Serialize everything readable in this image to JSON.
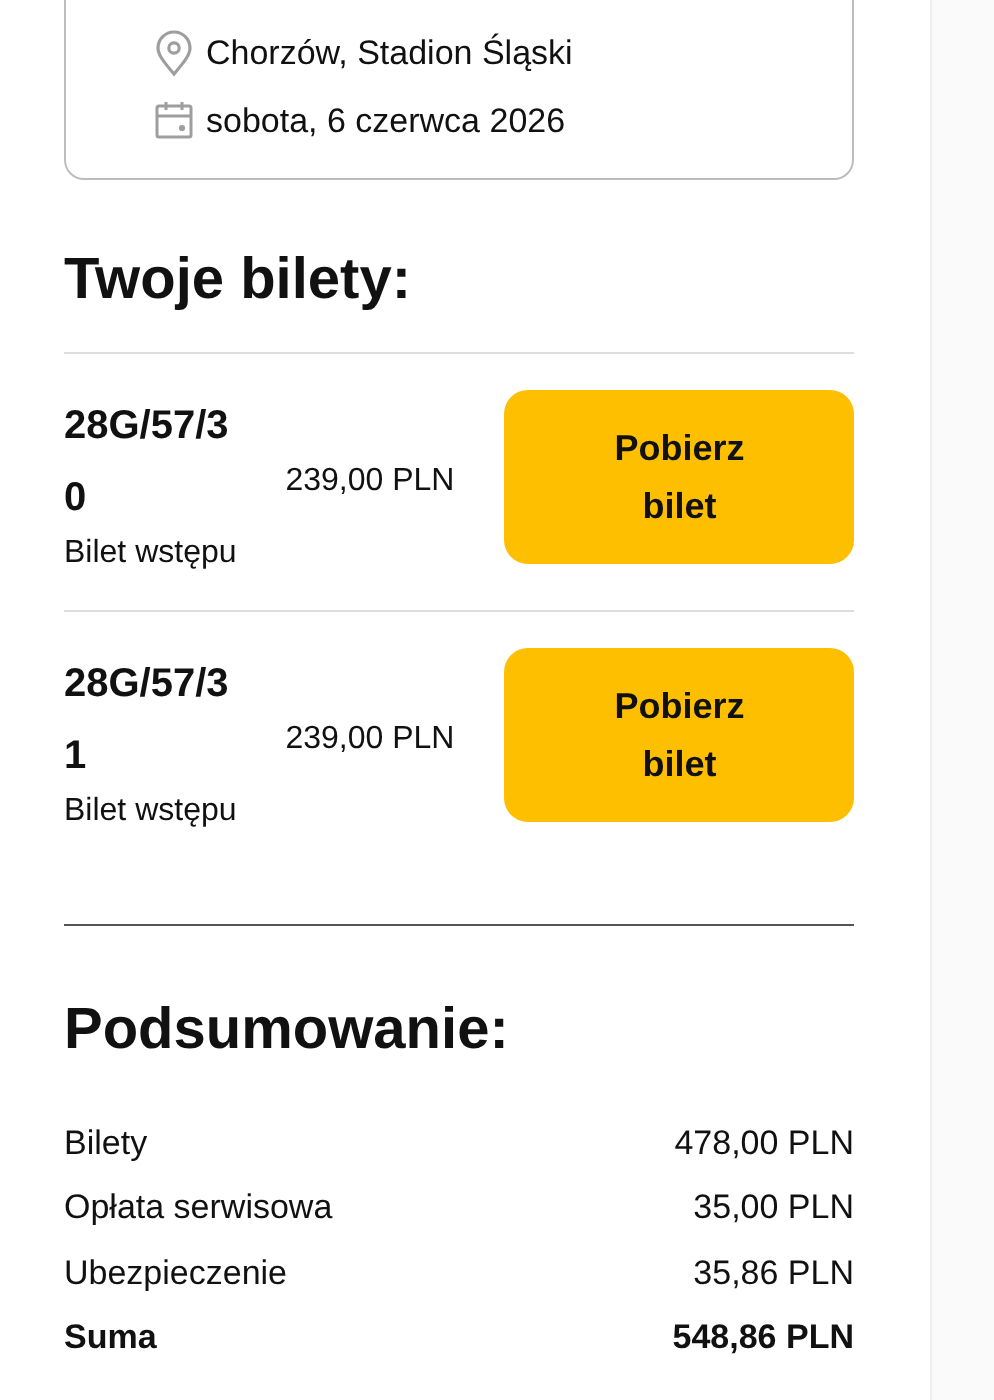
{
  "event": {
    "location": "Chorzów, Stadion Śląski",
    "date": "sobota, 6 czerwca 2026"
  },
  "tickets_heading": "Twoje bilety:",
  "tickets": [
    {
      "number": "28G/57/30",
      "price": "239,00 PLN",
      "type": "Bilet wstępu",
      "button": "Pobierz bilet"
    },
    {
      "number": "28G/57/31",
      "price": "239,00 PLN",
      "type": "Bilet wstępu",
      "button": "Pobierz bilet"
    }
  ],
  "summary": {
    "heading": "Podsumowanie:",
    "rows": [
      {
        "label": "Bilety",
        "value": "478,00 PLN",
        "kind": "item"
      },
      {
        "label": "Opłata serwisowa",
        "value": "35,00 PLN",
        "kind": "item"
      },
      {
        "label": "Ubezpieczenie",
        "value": "35,86 PLN",
        "kind": "item"
      },
      {
        "label": "Suma",
        "value": "548,86 PLN",
        "kind": "total"
      }
    ]
  }
}
